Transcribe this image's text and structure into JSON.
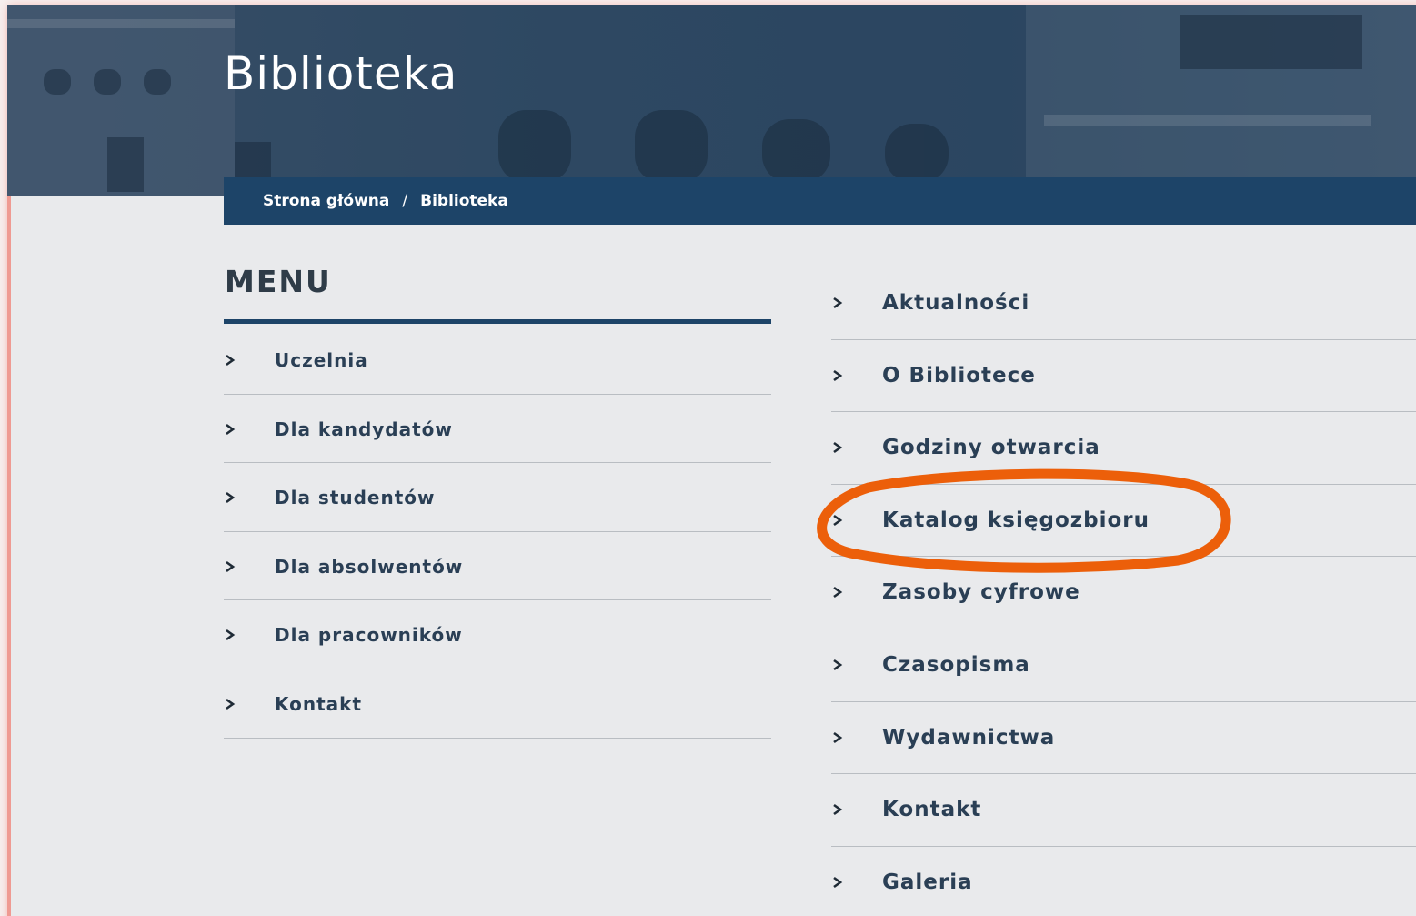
{
  "header": {
    "title": "Biblioteka"
  },
  "breadcrumb": {
    "home": "Strona główna",
    "separator": "/",
    "current": "Biblioteka"
  },
  "menu": {
    "title": "MENU",
    "items": [
      {
        "label": "Uczelnia"
      },
      {
        "label": "Dla kandydatów"
      },
      {
        "label": "Dla studentów"
      },
      {
        "label": "Dla absolwentów"
      },
      {
        "label": "Dla pracowników"
      },
      {
        "label": "Kontakt"
      }
    ]
  },
  "library_menu": {
    "items": [
      {
        "label": "Aktualności"
      },
      {
        "label": "O Bibliotece"
      },
      {
        "label": "Godziny otwarcia"
      },
      {
        "label": "Katalog księgozbioru"
      },
      {
        "label": "Zasoby cyfrowe"
      },
      {
        "label": "Czasopisma"
      },
      {
        "label": "Wydawnictwa"
      },
      {
        "label": "Kontakt"
      },
      {
        "label": "Galeria"
      }
    ]
  },
  "colors": {
    "accent": "#1d4468",
    "text": "#2a3f55",
    "highlight": "#ec5f0a"
  },
  "icons": {
    "chevron": "chevron-right-icon"
  }
}
